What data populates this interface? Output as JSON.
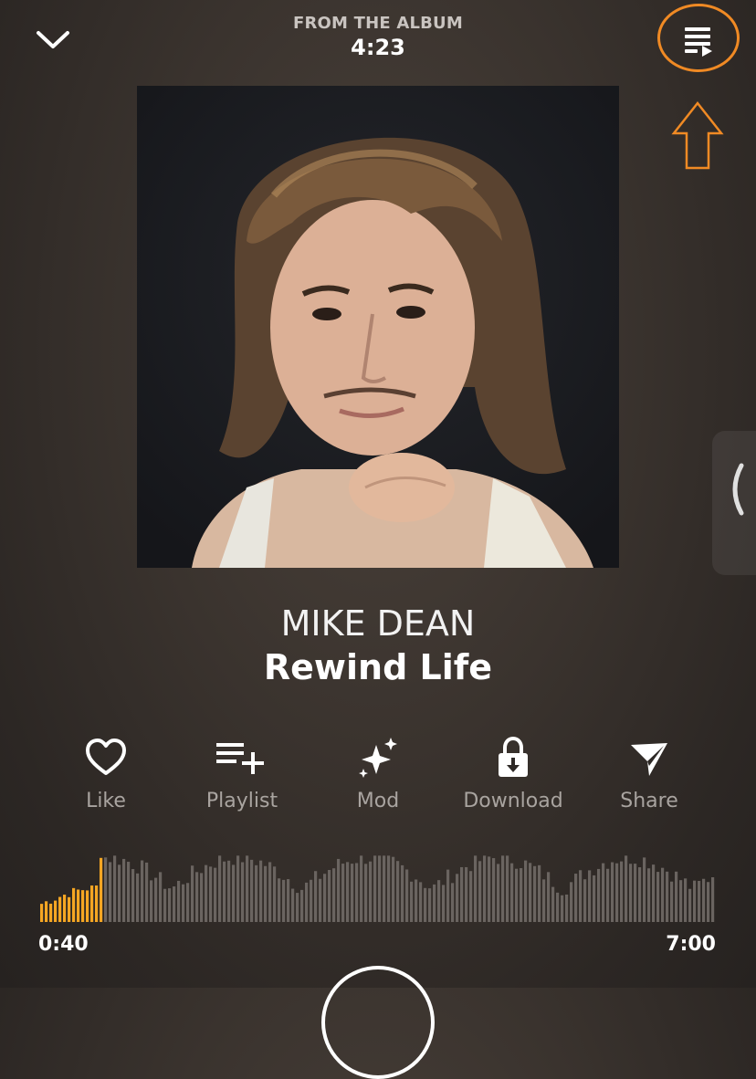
{
  "header": {
    "subtitle": "FROM THE ALBUM",
    "duration": "4:23"
  },
  "track": {
    "artist": "MIKE DEAN",
    "title": "Rewind Life"
  },
  "actions": [
    {
      "label": "Like",
      "icon": "heart-icon"
    },
    {
      "label": "Playlist",
      "icon": "playlist-add-icon"
    },
    {
      "label": "Mod",
      "icon": "sparkle-icon"
    },
    {
      "label": "Download",
      "icon": "lock-download-icon"
    },
    {
      "label": "Share",
      "icon": "send-icon"
    }
  ],
  "player": {
    "current_time": "0:40",
    "total_time": "7:00",
    "progress_fraction": 0.095
  },
  "colors": {
    "accent": "#f5a623",
    "annotation": "#f08a24",
    "wave_inactive": "#6a6460"
  },
  "icons": {
    "collapse": "chevron-down-icon",
    "queue": "queue-icon",
    "side_panel": "chevron-left-icon"
  }
}
